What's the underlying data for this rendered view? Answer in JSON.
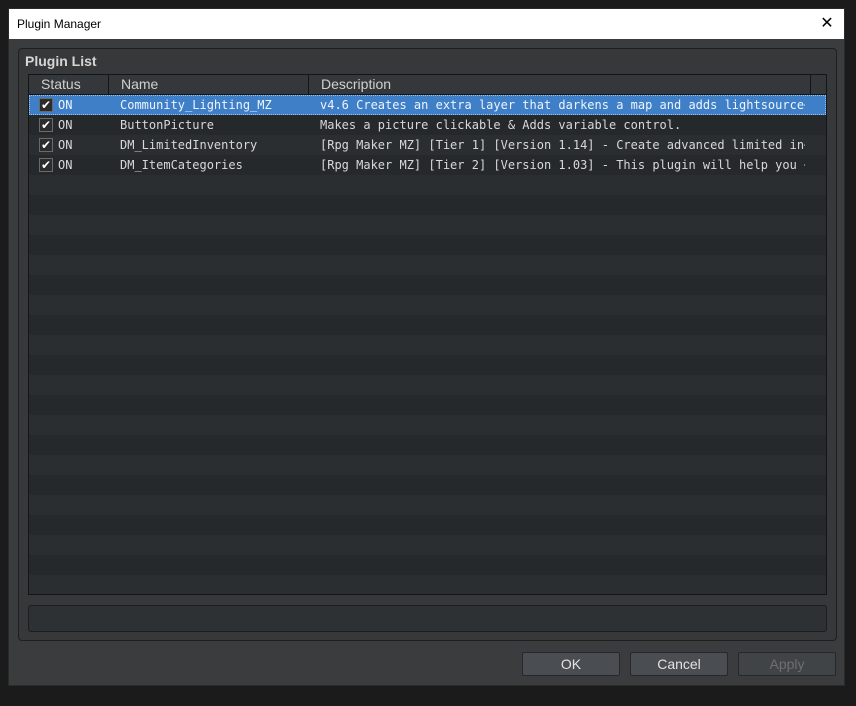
{
  "window": {
    "title": "Plugin Manager",
    "close_glyph": "✕"
  },
  "group": {
    "title": "Plugin List"
  },
  "columns": {
    "status": "Status",
    "name": "Name",
    "description": "Description"
  },
  "plugins": [
    {
      "checked": "✔",
      "status": "ON",
      "name": "Community_Lighting_MZ",
      "description": "v4.6 Creates an extra layer that darkens a map and adds lightsource⋯"
    },
    {
      "checked": "✔",
      "status": "ON",
      "name": "ButtonPicture",
      "description": "Makes a picture clickable & Adds variable control."
    },
    {
      "checked": "✔",
      "status": "ON",
      "name": "DM_LimitedInventory",
      "description": "[Rpg Maker MZ] [Tier 1] [Version 1.14] - Create advanced limited in⋯"
    },
    {
      "checked": "✔",
      "status": "ON",
      "name": "DM_ItemCategories",
      "description": "[Rpg Maker MZ] [Tier 2] [Version 1.03] - This plugin will help you ⋯"
    }
  ],
  "buttons": {
    "ok": "OK",
    "cancel": "Cancel",
    "apply": "Apply"
  },
  "colors": {
    "selection": "#3f7fc8",
    "background": "#3a3c3e"
  },
  "icons": {
    "close": "close-icon",
    "check": "checkmark-icon"
  }
}
